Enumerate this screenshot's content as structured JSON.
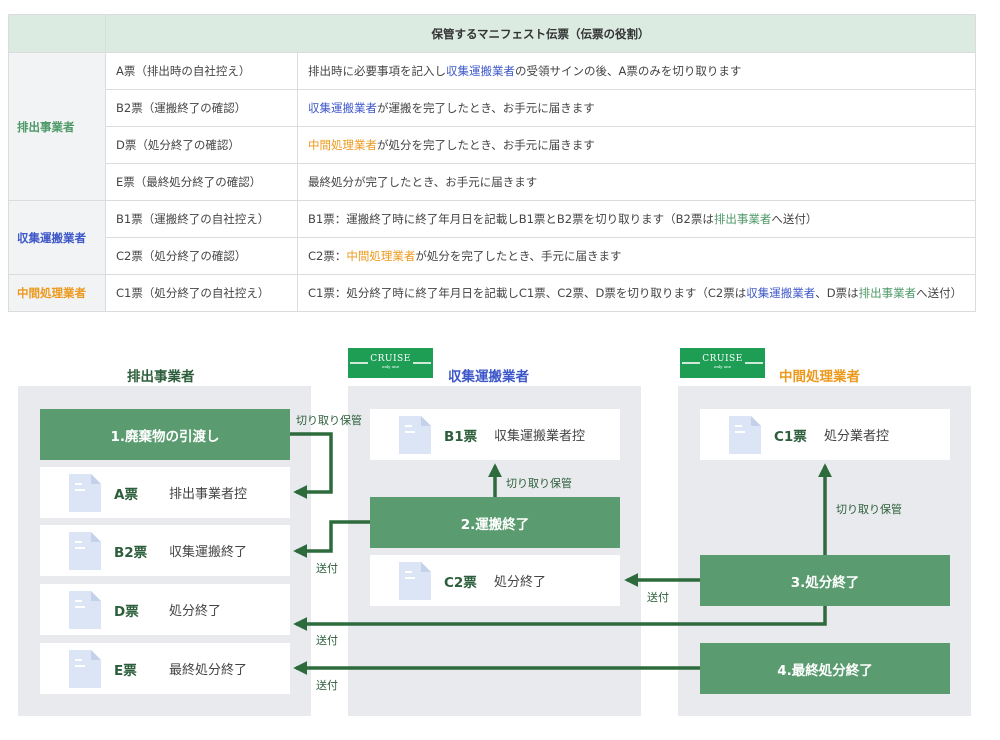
{
  "table": {
    "header": "保管するマニフェスト伝票（伝票の役割）",
    "groups": [
      {
        "name": "排出事業者",
        "color": "#4e9a68",
        "rows": [
          {
            "ticket": "A票（排出時の自社控え）",
            "desc": [
              {
                "t": "排出時に必要事項を記入し"
              },
              {
                "t": "収集運搬業者",
                "c": "blue"
              },
              {
                "t": "の受領サインの後、A票のみを切り取ります"
              }
            ]
          },
          {
            "ticket": "B2票（運搬終了の確認）",
            "desc": [
              {
                "t": "収集運搬業者",
                "c": "blue"
              },
              {
                "t": "が運搬を完了したとき、お手元に届きます"
              }
            ]
          },
          {
            "ticket": "D票（処分終了の確認）",
            "desc": [
              {
                "t": "中間処理業者",
                "c": "orange"
              },
              {
                "t": "が処分を完了したとき、お手元に届きます"
              }
            ]
          },
          {
            "ticket": "E票（最終処分終了の確認）",
            "desc": [
              {
                "t": "最終処分が完了したとき、お手元に届きます"
              }
            ]
          }
        ]
      },
      {
        "name": "収集運搬業者",
        "color": "#3e58c9",
        "rows": [
          {
            "ticket": "B1票（運搬終了の自社控え）",
            "desc": [
              {
                "t": "B1票：運搬終了時に終了年月日を記載しB1票とB2票を切り取ります（B2票は"
              },
              {
                "t": "排出事業者",
                "c": "green"
              },
              {
                "t": "へ送付）"
              }
            ]
          },
          {
            "ticket": "C2票（処分終了の確認）",
            "desc": [
              {
                "t": "C2票："
              },
              {
                "t": "中間処理業者",
                "c": "orange"
              },
              {
                "t": "が処分を完了したとき、手元に届きます"
              }
            ]
          }
        ]
      },
      {
        "name": "中間処理業者",
        "color": "#ec9a1e",
        "rows": [
          {
            "ticket": "C1票（処分終了の自社控え）",
            "desc": [
              {
                "t": "C1票：処分終了時に終了年月日を記載しC1票、C2票、D票を切り取ります（C2票は"
              },
              {
                "t": "収集運搬業者",
                "c": "blue"
              },
              {
                "t": "、D票は"
              },
              {
                "t": "排出事業者",
                "c": "green"
              },
              {
                "t": "へ送付）"
              }
            ]
          }
        ]
      }
    ]
  },
  "diagram": {
    "logo": {
      "word": "CRUISE",
      "tagline": "only one"
    },
    "columns": {
      "emitter": {
        "title": "排出事業者",
        "color": "#2d5e3b"
      },
      "collector": {
        "title": "収集運搬業者",
        "color": "#3e58c9"
      },
      "processor": {
        "title": "中間処理業者",
        "color": "#ec9a1e"
      }
    },
    "steps": {
      "s1": "1.廃棄物の引渡し",
      "s2": "2.運搬終了",
      "s3": "3.処分終了",
      "s4": "4.最終処分終了"
    },
    "cards": {
      "A": {
        "code": "A票",
        "label": "排出事業者控"
      },
      "B2": {
        "code": "B2票",
        "label": "収集運搬終了"
      },
      "D": {
        "code": "D票",
        "label": "処分終了"
      },
      "E": {
        "code": "E票",
        "label": "最終処分終了"
      },
      "B1": {
        "code": "B1票",
        "label": "収集運搬業者控"
      },
      "C2": {
        "code": "C2票",
        "label": "処分終了"
      },
      "C1": {
        "code": "C1票",
        "label": "処分業者控"
      }
    },
    "arrow_labels": {
      "keep1": "切り取り保管",
      "keep2": "切り取り保管",
      "keep3": "切り取り保管",
      "send_b2": "送付",
      "send_c2": "送付",
      "send_d": "送付",
      "send_e": "送付"
    },
    "colors": {
      "arrow": "#2d6b3c",
      "step": "#5a9c70",
      "doc_icon": "#dce5f5"
    }
  }
}
